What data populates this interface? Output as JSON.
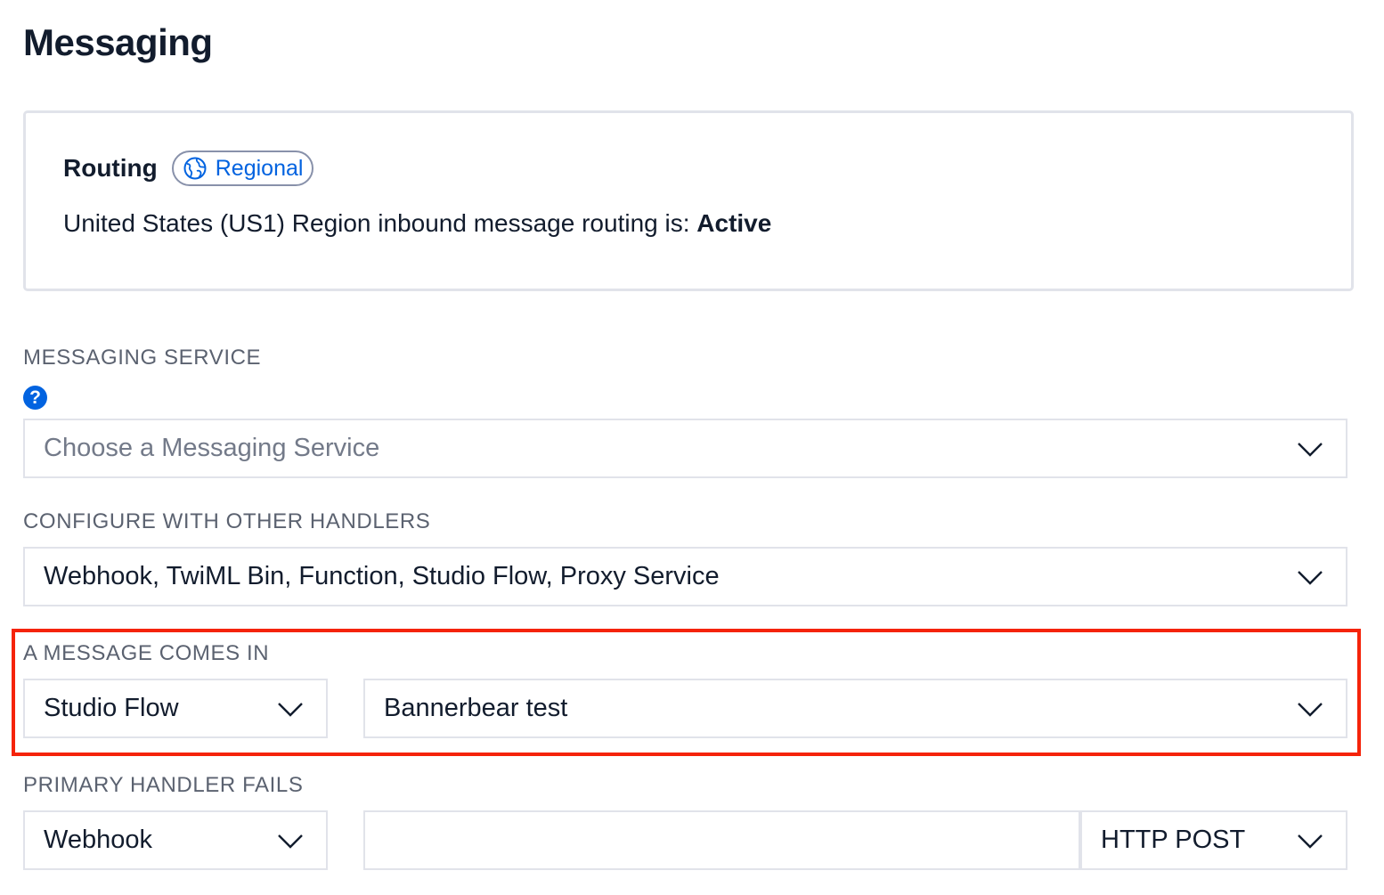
{
  "page": {
    "title": "Messaging"
  },
  "routing": {
    "title": "Routing",
    "badge": "Regional",
    "badge_icon": "globe-icon",
    "status_prefix": "United States (US1) Region inbound message routing is: ",
    "status_value": "Active"
  },
  "messaging_service": {
    "label": "MESSAGING SERVICE",
    "help_icon": "question-circle-icon",
    "help_glyph": "?",
    "placeholder": "Choose a Messaging Service"
  },
  "other_handlers": {
    "label": "CONFIGURE WITH OTHER HANDLERS",
    "value": "Webhook, TwiML Bin, Function, Studio Flow, Proxy Service"
  },
  "message_comes_in": {
    "label": "A MESSAGE COMES IN",
    "handler_type": "Studio Flow",
    "handler_target": "Bannerbear test"
  },
  "primary_handler_fails": {
    "label": "PRIMARY HANDLER FAILS",
    "handler_type": "Webhook",
    "url_value": "",
    "method": "HTTP POST"
  },
  "colors": {
    "accent": "#0263e0",
    "highlight": "#f5230a",
    "border": "#e1e3ea",
    "label": "#5b6270",
    "text": "#121c2d"
  }
}
